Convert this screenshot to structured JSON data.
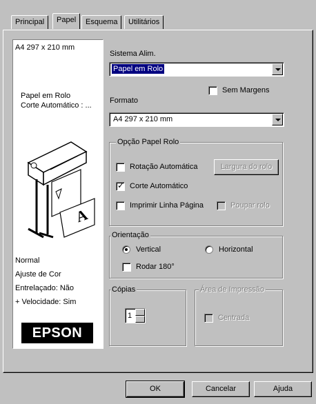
{
  "tabs": [
    {
      "label": "Principal",
      "active": false
    },
    {
      "label": "Papel",
      "active": true
    },
    {
      "label": "Esquema",
      "active": false
    },
    {
      "label": "Utilitários",
      "active": false
    }
  ],
  "preview": {
    "paper_size": "A4 297 x 210 mm",
    "source_line1": "Papel em Rolo",
    "source_line2": "Corte Automático : ...",
    "info": [
      "Normal",
      "Ajuste de Cor",
      "Entrelaçado: Não",
      "+ Velocidade: Sim"
    ],
    "logo": "EPSON"
  },
  "sistema_alim": {
    "label": "Sistema Alim.",
    "value": "Papel em Rolo"
  },
  "sem_margens": {
    "label": "Sem Margens",
    "checked": false
  },
  "formato": {
    "label": "Formato",
    "value": "A4 297 x 210 mm"
  },
  "opcao_papel_rolo": {
    "title": "Opção Papel Rolo",
    "rotacao_label": "Rotação Automática",
    "rotacao_checked": false,
    "largura_button": "Largura do rolo",
    "corte_label": "Corte Automático",
    "corte_checked": true,
    "imprimir_label": "Imprimir Linha Página",
    "imprimir_checked": false,
    "poupar_label": "Poupar rolo",
    "poupar_checked": false
  },
  "orientacao": {
    "title": "Orientação",
    "vertical_label": "Vertical",
    "horizontal_label": "Horizontal",
    "selected": "vertical",
    "rodar_label": "Rodar 180°",
    "rodar_checked": false
  },
  "copias": {
    "title": "Cópias",
    "value": "1"
  },
  "area_impressao": {
    "title": "Área de Impressão",
    "centrada_label": "Centrada"
  },
  "buttons": {
    "ok": "OK",
    "cancel": "Cancelar",
    "help": "Ajuda"
  },
  "colors": {
    "dialog_bg": "#c0c0c0",
    "selection": "#000080",
    "logo_bg": "#000000"
  }
}
